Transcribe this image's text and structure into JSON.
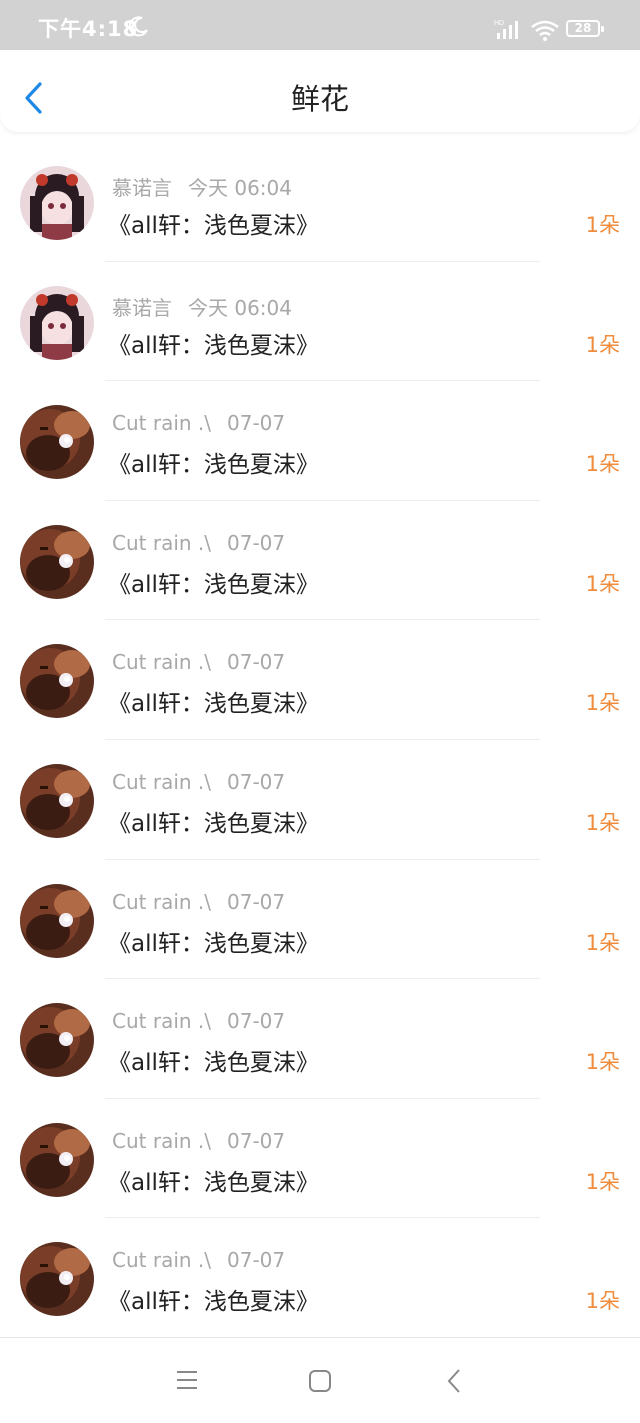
{
  "status_bar": {
    "time": "下午4:18",
    "battery": "28",
    "icons": [
      "moon-icon",
      "signal-icon",
      "wifi-icon",
      "battery-icon"
    ]
  },
  "header": {
    "title": "鲜花",
    "back_icon": "chevron-left-icon",
    "accent_color": "#1e88e5"
  },
  "records": [
    {
      "user": "慕诺言",
      "date": "今天 06:04",
      "message": "《all轩：浅色夏沫》",
      "count": "1朵",
      "avatar": "anime"
    },
    {
      "user": "慕诺言",
      "date": "今天 06:04",
      "message": "《all轩：浅色夏沫》",
      "count": "1朵",
      "avatar": "anime"
    },
    {
      "user": "Cut rain .\\",
      "date": "07-07",
      "message": "《all轩：浅色夏沫》",
      "count": "1朵",
      "avatar": "photo"
    },
    {
      "user": "Cut rain .\\",
      "date": "07-07",
      "message": "《all轩：浅色夏沫》",
      "count": "1朵",
      "avatar": "photo"
    },
    {
      "user": "Cut rain .\\",
      "date": "07-07",
      "message": "《all轩：浅色夏沫》",
      "count": "1朵",
      "avatar": "photo"
    },
    {
      "user": "Cut rain .\\",
      "date": "07-07",
      "message": "《all轩：浅色夏沫》",
      "count": "1朵",
      "avatar": "photo"
    },
    {
      "user": "Cut rain .\\",
      "date": "07-07",
      "message": "《all轩：浅色夏沫》",
      "count": "1朵",
      "avatar": "photo"
    },
    {
      "user": "Cut rain .\\",
      "date": "07-07",
      "message": "《all轩：浅色夏沫》",
      "count": "1朵",
      "avatar": "photo"
    },
    {
      "user": "Cut rain .\\",
      "date": "07-07",
      "message": "《all轩：浅色夏沫》",
      "count": "1朵",
      "avatar": "photo"
    },
    {
      "user": "Cut rain .\\",
      "date": "07-07",
      "message": "《all轩：浅色夏沫》",
      "count": "1朵",
      "avatar": "photo"
    }
  ],
  "nav_bar": {
    "icons": [
      "menu-icon",
      "home-square-icon",
      "back-chevron-icon"
    ]
  },
  "colors": {
    "status_bar_bg": "#d2d2d2",
    "count_color": "#f08c3c",
    "meta_color": "#a8a8a8"
  }
}
